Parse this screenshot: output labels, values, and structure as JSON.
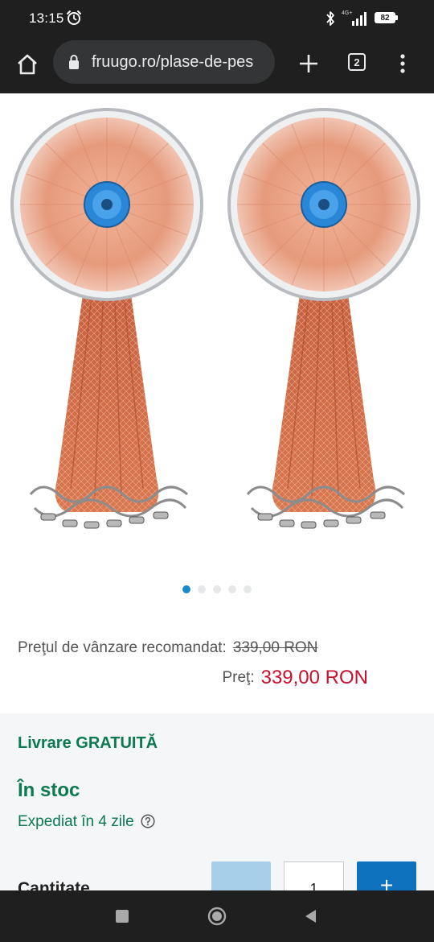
{
  "status_bar": {
    "time": "13:15",
    "network": "4G+",
    "battery": "82"
  },
  "browser": {
    "url": "fruugo.ro/plase-de-pes",
    "tab_count": "2"
  },
  "carousel": {
    "total": 5,
    "active_index": 0
  },
  "pricing": {
    "rrp_label": "Preţul de vânzare recomandat:",
    "rrp_value": "339,00 RON",
    "price_label": "Preţ:",
    "price_value": "339,00 RON"
  },
  "delivery": {
    "free_delivery": "Livrare GRATUITĂ",
    "stock_status": "În stoc",
    "dispatch_text": "Expediat în 4 zile"
  },
  "quantity": {
    "label": "Cantitate",
    "value": "1",
    "plus_label": "+"
  },
  "colors": {
    "accent_blue": "#1a88c9",
    "price_red": "#c8102e",
    "stock_green": "#0b7a50"
  }
}
